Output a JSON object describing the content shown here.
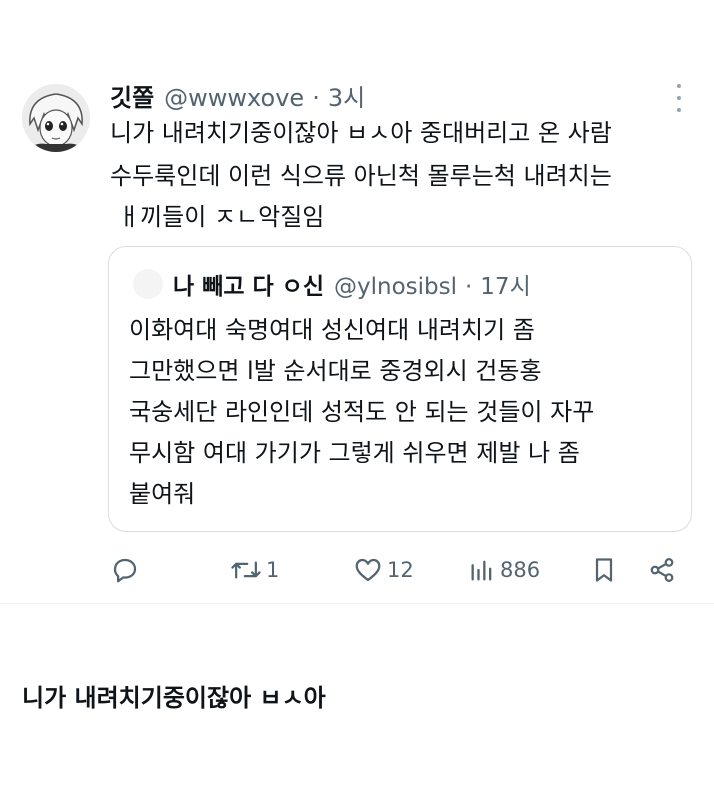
{
  "tweet": {
    "display_name": "깃쫄",
    "handle": "@wwwxove",
    "separator": "·",
    "time": "3시",
    "body_lines": [
      "니가 내려치기중이잖아 ㅂㅅ아 중대버리고 온 사람",
      "수두룩인데 이런 식으류 아닌척 몰루는척 내려치는",
      "ㅐ끼들이 ㅈㄴ악질임"
    ]
  },
  "quote": {
    "display_name": "나 빼고 다 ㅇ신",
    "handle": "@ylnosibsl",
    "separator": "·",
    "time": "17시",
    "body_lines": [
      "이화여대 숙명여대 성신여대 내려치기 좀",
      "그만했으면  l발 순서대로 중경외시 건동홍",
      "국숭세단 라인인데 성적도 안 되는 것들이 자꾸",
      "무시함 여대 가기가 그렇게 쉬우면 제발 나 좀",
      "붙여줘"
    ]
  },
  "actions": {
    "reply_icon": "reply-icon",
    "retweet_icon": "retweet-icon",
    "retweet_count": "1",
    "like_icon": "heart-icon",
    "like_count": "12",
    "views_icon": "views-icon",
    "views_count": "886",
    "bookmark_icon": "bookmark-icon",
    "share_icon": "share-icon"
  },
  "caption": "니가 내려치기중이잖아 ㅂㅅ아",
  "colors": {
    "text": "#0f1419",
    "secondary": "#536471",
    "border": "#d8dee3"
  }
}
